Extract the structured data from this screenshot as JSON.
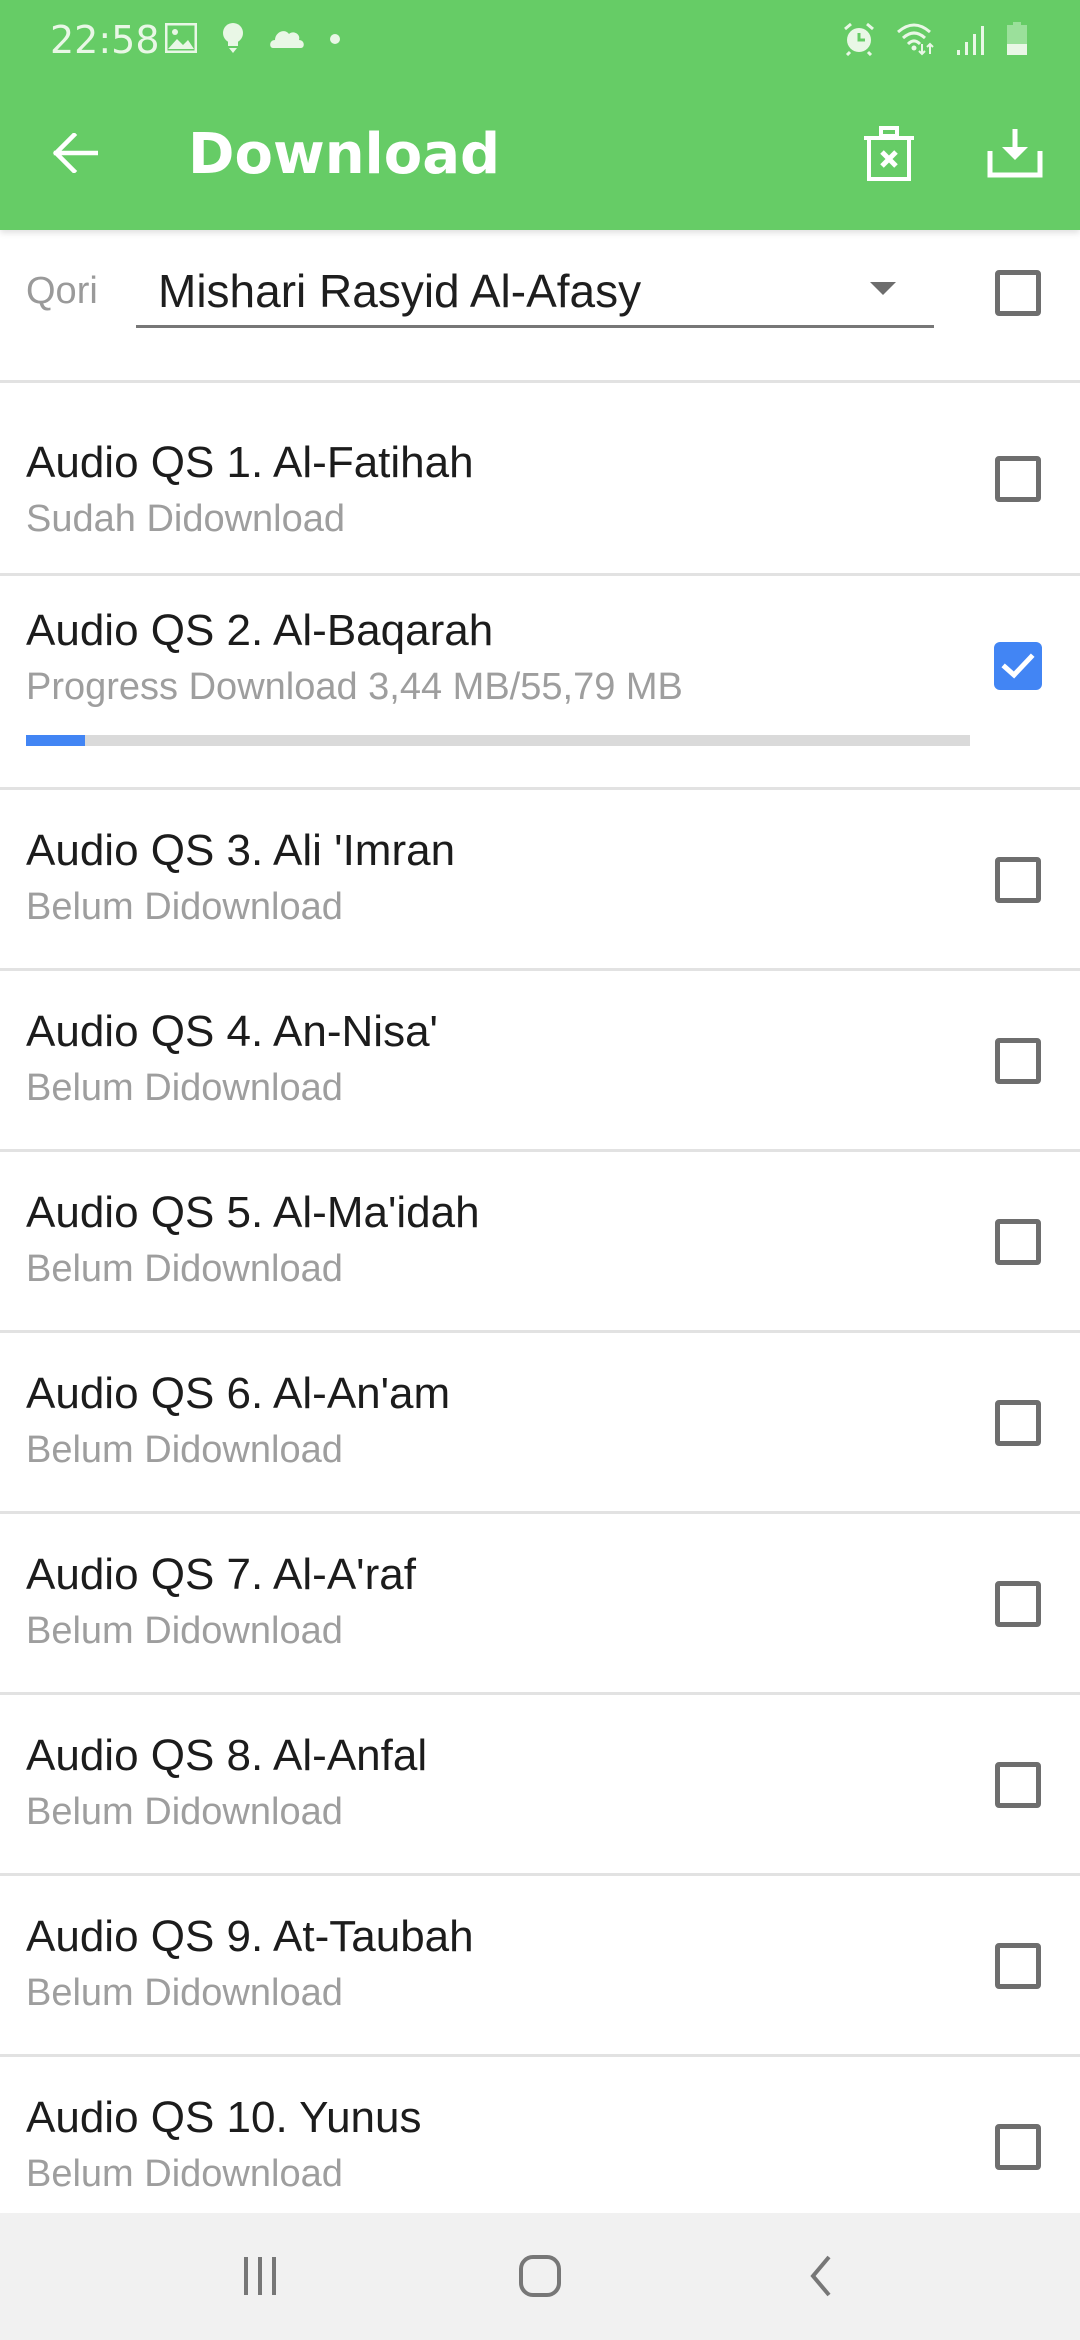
{
  "status_bar": {
    "time": "22:58",
    "left_icons": [
      "image-icon",
      "lightbulb-icon",
      "cloud-icon",
      "dot-icon"
    ],
    "right_icons": [
      "alarm-icon",
      "wifi-icon",
      "signal-icon",
      "battery-icon"
    ]
  },
  "app_bar": {
    "title": "Download",
    "back_icon": "arrow-back-icon",
    "actions": [
      {
        "name": "delete-all-button",
        "icon": "trash-x-icon"
      },
      {
        "name": "download-all-button",
        "icon": "download-icon"
      }
    ],
    "color": "#66CC66"
  },
  "qori": {
    "label": "Qori",
    "selected": "Mishari Rasyid Al-Afasy",
    "select_all_checked": false
  },
  "items": [
    {
      "title": "Audio QS 1. Al-Fatihah",
      "status": "Sudah Didownload",
      "checked": false
    },
    {
      "title": "Audio QS 2. Al-Baqarah",
      "status": "Progress Download 3,44 MB/55,79 MB",
      "checked": true,
      "progress": 0.062
    },
    {
      "title": "Audio QS 3. Ali 'Imran",
      "status": "Belum Didownload",
      "checked": false
    },
    {
      "title": "Audio QS 4. An-Nisa'",
      "status": "Belum Didownload",
      "checked": false
    },
    {
      "title": "Audio QS 5. Al-Ma'idah",
      "status": "Belum Didownload",
      "checked": false
    },
    {
      "title": "Audio QS 6. Al-An'am",
      "status": "Belum Didownload",
      "checked": false
    },
    {
      "title": "Audio QS 7. Al-A'raf",
      "status": "Belum Didownload",
      "checked": false
    },
    {
      "title": "Audio QS 8. Al-Anfal",
      "status": "Belum Didownload",
      "checked": false
    },
    {
      "title": "Audio QS 9. At-Taubah",
      "status": "Belum Didownload",
      "checked": false
    },
    {
      "title": "Audio QS 10. Yunus",
      "status": "Belum Didownload",
      "checked": false
    }
  ],
  "colors": {
    "accent": "#4285F4",
    "checkbox_border": "#6E6E6E",
    "subtitle": "#9E9E9E"
  },
  "nav_bar": {
    "buttons": [
      "recent-apps-icon",
      "home-icon",
      "back-icon"
    ]
  }
}
